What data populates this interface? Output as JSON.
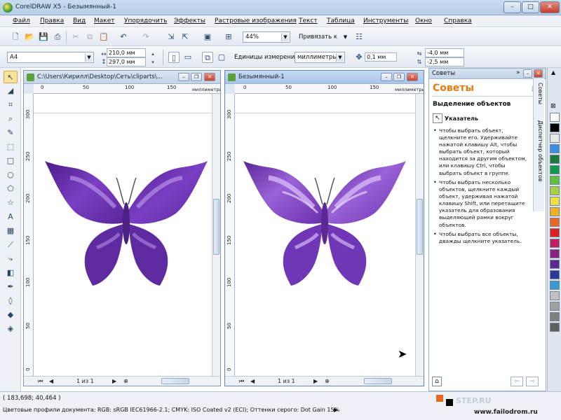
{
  "window": {
    "title": "CorelDRAW X5 - Безымянный-1",
    "min": "–",
    "max": "□",
    "close": "✕"
  },
  "menu": [
    "Файл",
    "Правка",
    "Вид",
    "Макет",
    "Упорядочить",
    "Эффекты",
    "Растровые изображения",
    "Текст",
    "Таблица",
    "Инструменты",
    "Окно",
    "Справка"
  ],
  "standard_toolbar": {
    "zoom": "44%",
    "snap": "Привязать к"
  },
  "property_bar": {
    "paper_size": "A4",
    "width": "210,0 мм",
    "height": "297,0 мм",
    "units_label": "Единицы измерения:",
    "units_value": "миллиметры",
    "nudge": "0,1 мм",
    "dup_x": "-4,0 мм",
    "dup_y": "-2,5 мм"
  },
  "doc1": {
    "title": "C:\\Users\\Кирилл\\Desktop\\Сеть\\cliparts\\...",
    "ruler_h": [
      "0",
      "50",
      "100",
      "150"
    ],
    "ruler_unit": "миллиметры",
    "ruler_v": [
      "300",
      "250",
      "200",
      "150",
      "100",
      "50",
      "0"
    ],
    "page_nav": "1 из 1"
  },
  "doc2": {
    "title": "Безымянный-1",
    "ruler_h": [
      "0",
      "50",
      "100",
      "150"
    ],
    "ruler_unit": "миллиметры",
    "ruler_v": [
      "300",
      "250",
      "200",
      "150",
      "100",
      "50",
      "0"
    ],
    "page_nav": "1 из 1"
  },
  "docker": {
    "caption": "Советы",
    "heading": "Советы",
    "section": "Выделение объектов",
    "tool_name": "Указатель",
    "tip1": [
      "Чтобы выбрать объект,",
      "щелкните его. Удерживайте",
      "нажатой клавишу Alt, чтобы",
      "выбрать объект, который",
      "находится за другим объектом,",
      "или клавишу Ctrl, чтобы",
      "выбрать объект в группе."
    ],
    "tip2": [
      "Чтобы выбрать несколько",
      "объектов, щелкните каждый",
      "объект, удерживая нажатой",
      "клавишу Shift, или перетащите",
      "указатель для образования",
      "выделяющей рамки вокруг",
      "объектов."
    ],
    "tip3": [
      "Чтобы выбрать все объекты,",
      "дважды щелкните указатель."
    ],
    "tabs": [
      "Советы",
      "Диспетчер объектов"
    ]
  },
  "palette": [
    "#ffffff",
    "#000000",
    "#e8e8e8",
    "#3a8ee0",
    "#1f7a3a",
    "#0e9a4a",
    "#60c040",
    "#a8d040",
    "#f0e040",
    "#f0b020",
    "#e86a20",
    "#e02020",
    "#c02060",
    "#8a2080",
    "#5a2a90",
    "#2a3a9a",
    "#3a9ad0",
    "#c0c0c0",
    "#a0a0a0",
    "#808080",
    "#606060"
  ],
  "status": {
    "coords": "( 183,698; 40,464 )",
    "profiles": "Цветовые профили документа: RGB: sRGB IEC61966-2.1; CMYK: ISO Coated v2 (ECI); Оттенки серого: Dot Gain 15%",
    "watermark_url": "www.failodrom.ru",
    "watermark_mark": "STEP.RU"
  },
  "colors": {
    "accent": "#e47a10",
    "butterfly_dark": "#4b1a86",
    "butterfly_mid": "#7a3fc4",
    "butterfly_light": "#b88ee6"
  }
}
